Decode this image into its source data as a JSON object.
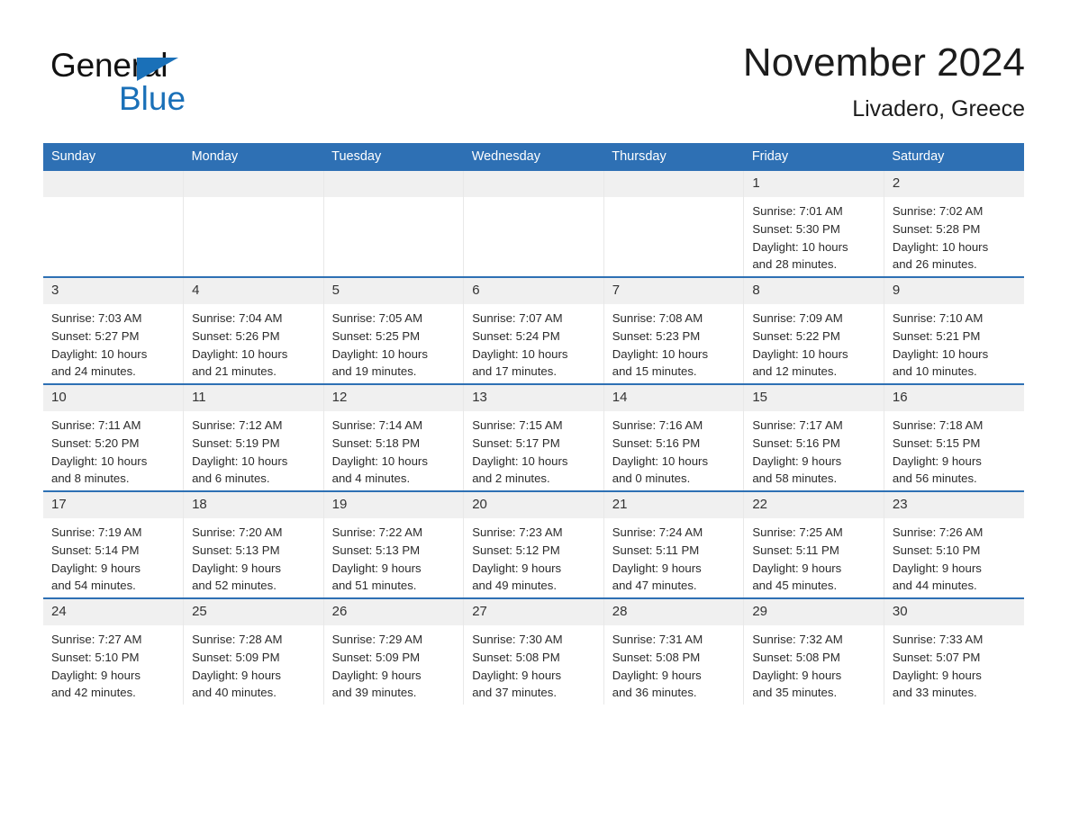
{
  "brand": {
    "name_part1": "General",
    "name_part2": "Blue",
    "logo_icon": "triangle-flag-icon",
    "color_black": "#111111",
    "color_blue": "#1a70b8"
  },
  "header": {
    "month_title": "November 2024",
    "location": "Livadero, Greece"
  },
  "theme": {
    "header_blue": "#2e70b4",
    "row_border_blue": "#2e70b4",
    "daynum_background": "#f0f0f0",
    "cell_background": "#ffffff"
  },
  "weekdays": [
    "Sunday",
    "Monday",
    "Tuesday",
    "Wednesday",
    "Thursday",
    "Friday",
    "Saturday"
  ],
  "weeks": [
    {
      "days": [
        {
          "number": "",
          "sunrise": "",
          "sunset": "",
          "daylight_line1": "",
          "daylight_line2": ""
        },
        {
          "number": "",
          "sunrise": "",
          "sunset": "",
          "daylight_line1": "",
          "daylight_line2": ""
        },
        {
          "number": "",
          "sunrise": "",
          "sunset": "",
          "daylight_line1": "",
          "daylight_line2": ""
        },
        {
          "number": "",
          "sunrise": "",
          "sunset": "",
          "daylight_line1": "",
          "daylight_line2": ""
        },
        {
          "number": "",
          "sunrise": "",
          "sunset": "",
          "daylight_line1": "",
          "daylight_line2": ""
        },
        {
          "number": "1",
          "sunrise": "Sunrise: 7:01 AM",
          "sunset": "Sunset: 5:30 PM",
          "daylight_line1": "Daylight: 10 hours",
          "daylight_line2": "and 28 minutes."
        },
        {
          "number": "2",
          "sunrise": "Sunrise: 7:02 AM",
          "sunset": "Sunset: 5:28 PM",
          "daylight_line1": "Daylight: 10 hours",
          "daylight_line2": "and 26 minutes."
        }
      ]
    },
    {
      "days": [
        {
          "number": "3",
          "sunrise": "Sunrise: 7:03 AM",
          "sunset": "Sunset: 5:27 PM",
          "daylight_line1": "Daylight: 10 hours",
          "daylight_line2": "and 24 minutes."
        },
        {
          "number": "4",
          "sunrise": "Sunrise: 7:04 AM",
          "sunset": "Sunset: 5:26 PM",
          "daylight_line1": "Daylight: 10 hours",
          "daylight_line2": "and 21 minutes."
        },
        {
          "number": "5",
          "sunrise": "Sunrise: 7:05 AM",
          "sunset": "Sunset: 5:25 PM",
          "daylight_line1": "Daylight: 10 hours",
          "daylight_line2": "and 19 minutes."
        },
        {
          "number": "6",
          "sunrise": "Sunrise: 7:07 AM",
          "sunset": "Sunset: 5:24 PM",
          "daylight_line1": "Daylight: 10 hours",
          "daylight_line2": "and 17 minutes."
        },
        {
          "number": "7",
          "sunrise": "Sunrise: 7:08 AM",
          "sunset": "Sunset: 5:23 PM",
          "daylight_line1": "Daylight: 10 hours",
          "daylight_line2": "and 15 minutes."
        },
        {
          "number": "8",
          "sunrise": "Sunrise: 7:09 AM",
          "sunset": "Sunset: 5:22 PM",
          "daylight_line1": "Daylight: 10 hours",
          "daylight_line2": "and 12 minutes."
        },
        {
          "number": "9",
          "sunrise": "Sunrise: 7:10 AM",
          "sunset": "Sunset: 5:21 PM",
          "daylight_line1": "Daylight: 10 hours",
          "daylight_line2": "and 10 minutes."
        }
      ]
    },
    {
      "days": [
        {
          "number": "10",
          "sunrise": "Sunrise: 7:11 AM",
          "sunset": "Sunset: 5:20 PM",
          "daylight_line1": "Daylight: 10 hours",
          "daylight_line2": "and 8 minutes."
        },
        {
          "number": "11",
          "sunrise": "Sunrise: 7:12 AM",
          "sunset": "Sunset: 5:19 PM",
          "daylight_line1": "Daylight: 10 hours",
          "daylight_line2": "and 6 minutes."
        },
        {
          "number": "12",
          "sunrise": "Sunrise: 7:14 AM",
          "sunset": "Sunset: 5:18 PM",
          "daylight_line1": "Daylight: 10 hours",
          "daylight_line2": "and 4 minutes."
        },
        {
          "number": "13",
          "sunrise": "Sunrise: 7:15 AM",
          "sunset": "Sunset: 5:17 PM",
          "daylight_line1": "Daylight: 10 hours",
          "daylight_line2": "and 2 minutes."
        },
        {
          "number": "14",
          "sunrise": "Sunrise: 7:16 AM",
          "sunset": "Sunset: 5:16 PM",
          "daylight_line1": "Daylight: 10 hours",
          "daylight_line2": "and 0 minutes."
        },
        {
          "number": "15",
          "sunrise": "Sunrise: 7:17 AM",
          "sunset": "Sunset: 5:16 PM",
          "daylight_line1": "Daylight: 9 hours",
          "daylight_line2": "and 58 minutes."
        },
        {
          "number": "16",
          "sunrise": "Sunrise: 7:18 AM",
          "sunset": "Sunset: 5:15 PM",
          "daylight_line1": "Daylight: 9 hours",
          "daylight_line2": "and 56 minutes."
        }
      ]
    },
    {
      "days": [
        {
          "number": "17",
          "sunrise": "Sunrise: 7:19 AM",
          "sunset": "Sunset: 5:14 PM",
          "daylight_line1": "Daylight: 9 hours",
          "daylight_line2": "and 54 minutes."
        },
        {
          "number": "18",
          "sunrise": "Sunrise: 7:20 AM",
          "sunset": "Sunset: 5:13 PM",
          "daylight_line1": "Daylight: 9 hours",
          "daylight_line2": "and 52 minutes."
        },
        {
          "number": "19",
          "sunrise": "Sunrise: 7:22 AM",
          "sunset": "Sunset: 5:13 PM",
          "daylight_line1": "Daylight: 9 hours",
          "daylight_line2": "and 51 minutes."
        },
        {
          "number": "20",
          "sunrise": "Sunrise: 7:23 AM",
          "sunset": "Sunset: 5:12 PM",
          "daylight_line1": "Daylight: 9 hours",
          "daylight_line2": "and 49 minutes."
        },
        {
          "number": "21",
          "sunrise": "Sunrise: 7:24 AM",
          "sunset": "Sunset: 5:11 PM",
          "daylight_line1": "Daylight: 9 hours",
          "daylight_line2": "and 47 minutes."
        },
        {
          "number": "22",
          "sunrise": "Sunrise: 7:25 AM",
          "sunset": "Sunset: 5:11 PM",
          "daylight_line1": "Daylight: 9 hours",
          "daylight_line2": "and 45 minutes."
        },
        {
          "number": "23",
          "sunrise": "Sunrise: 7:26 AM",
          "sunset": "Sunset: 5:10 PM",
          "daylight_line1": "Daylight: 9 hours",
          "daylight_line2": "and 44 minutes."
        }
      ]
    },
    {
      "days": [
        {
          "number": "24",
          "sunrise": "Sunrise: 7:27 AM",
          "sunset": "Sunset: 5:10 PM",
          "daylight_line1": "Daylight: 9 hours",
          "daylight_line2": "and 42 minutes."
        },
        {
          "number": "25",
          "sunrise": "Sunrise: 7:28 AM",
          "sunset": "Sunset: 5:09 PM",
          "daylight_line1": "Daylight: 9 hours",
          "daylight_line2": "and 40 minutes."
        },
        {
          "number": "26",
          "sunrise": "Sunrise: 7:29 AM",
          "sunset": "Sunset: 5:09 PM",
          "daylight_line1": "Daylight: 9 hours",
          "daylight_line2": "and 39 minutes."
        },
        {
          "number": "27",
          "sunrise": "Sunrise: 7:30 AM",
          "sunset": "Sunset: 5:08 PM",
          "daylight_line1": "Daylight: 9 hours",
          "daylight_line2": "and 37 minutes."
        },
        {
          "number": "28",
          "sunrise": "Sunrise: 7:31 AM",
          "sunset": "Sunset: 5:08 PM",
          "daylight_line1": "Daylight: 9 hours",
          "daylight_line2": "and 36 minutes."
        },
        {
          "number": "29",
          "sunrise": "Sunrise: 7:32 AM",
          "sunset": "Sunset: 5:08 PM",
          "daylight_line1": "Daylight: 9 hours",
          "daylight_line2": "and 35 minutes."
        },
        {
          "number": "30",
          "sunrise": "Sunrise: 7:33 AM",
          "sunset": "Sunset: 5:07 PM",
          "daylight_line1": "Daylight: 9 hours",
          "daylight_line2": "and 33 minutes."
        }
      ]
    }
  ]
}
